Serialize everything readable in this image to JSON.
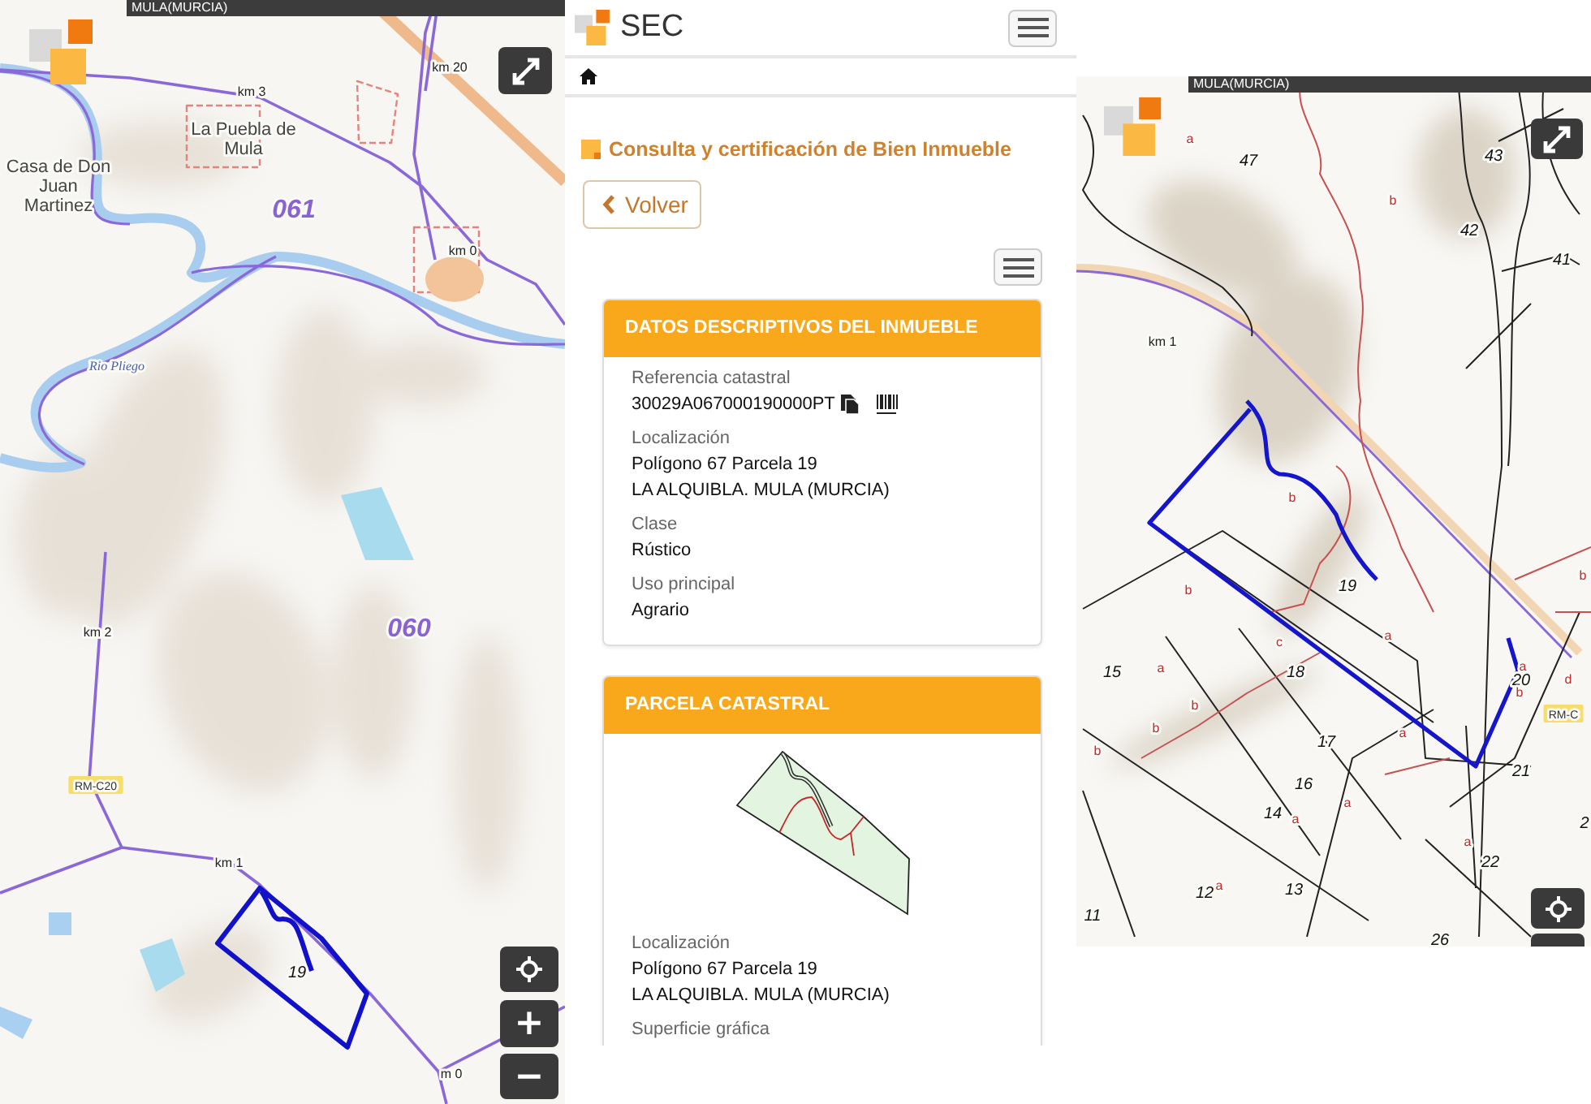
{
  "left_map": {
    "region_label": "MULA(MURCIA)",
    "labels": [
      {
        "kind": "km",
        "text": "km 3"
      },
      {
        "kind": "km",
        "text": "km 20"
      },
      {
        "kind": "place",
        "lines": [
          "La Puebla de",
          "Mula"
        ]
      },
      {
        "kind": "place",
        "lines": [
          "Casa de Don",
          "Juan",
          "Martinez"
        ]
      },
      {
        "kind": "zone",
        "text": "061"
      },
      {
        "kind": "km",
        "text": "km 0"
      },
      {
        "kind": "river",
        "text": "Rio Pliego"
      },
      {
        "kind": "km",
        "text": "km 2"
      },
      {
        "kind": "zone",
        "text": "060"
      },
      {
        "kind": "road",
        "text": "RM-C20"
      },
      {
        "kind": "km",
        "text": "km 1"
      },
      {
        "kind": "parcel",
        "text": "19"
      },
      {
        "kind": "km",
        "text": "m 0"
      }
    ],
    "zoom_in": "+",
    "zoom_out": "−"
  },
  "app": {
    "brand": "SEC",
    "page_title": "Consulta y certificación de Bien Inmueble",
    "back_button": "Volver",
    "cards": [
      {
        "kind": "details",
        "title": "DATOS DESCRIPTIVOS DEL INMUEBLE",
        "fields": [
          {
            "kind": "reference",
            "label": "Referencia catastral",
            "lines": [
              "30029A067000190000PT"
            ]
          },
          {
            "kind": "plain",
            "label": "Localización",
            "lines": [
              "Polígono 67 Parcela 19",
              "LA ALQUIBLA. MULA (MURCIA)"
            ]
          },
          {
            "kind": "plain",
            "label": "Clase",
            "lines": [
              "Rústico"
            ]
          },
          {
            "kind": "plain",
            "label": "Uso principal",
            "lines": [
              "Agrario"
            ]
          }
        ]
      },
      {
        "kind": "parcel",
        "title": "PARCELA CATASTRAL",
        "fields": [
          {
            "kind": "plain",
            "label": "Localización",
            "lines": [
              "Polígono 67 Parcela 19",
              "LA ALQUIBLA. MULA (MURCIA)"
            ]
          },
          {
            "label": "Superficie gráfica"
          }
        ]
      }
    ]
  },
  "right_map": {
    "region_label": "MULA(MURCIA)",
    "labels": [
      {
        "kind": "subparcel",
        "text": "a"
      },
      {
        "kind": "parcel",
        "text": "47"
      },
      {
        "kind": "subparcel",
        "text": "b"
      },
      {
        "kind": "parcel",
        "text": "43"
      },
      {
        "kind": "parcel",
        "text": "42"
      },
      {
        "kind": "parcel",
        "text": "41"
      },
      {
        "kind": "km",
        "text": "km 1"
      },
      {
        "kind": "subparcel",
        "text": "b"
      },
      {
        "kind": "subparcel",
        "text": "b"
      },
      {
        "kind": "parcel",
        "text": "19"
      },
      {
        "kind": "subparcel",
        "text": "a"
      },
      {
        "kind": "subparcel",
        "text": "b"
      },
      {
        "kind": "parcel",
        "text": "15"
      },
      {
        "kind": "subparcel",
        "text": "a"
      },
      {
        "kind": "subparcel",
        "text": "c"
      },
      {
        "kind": "parcel",
        "text": "18"
      },
      {
        "kind": "subparcel",
        "text": "a"
      },
      {
        "kind": "parcel",
        "text": "20"
      },
      {
        "kind": "subparcel",
        "text": "b"
      },
      {
        "kind": "subparcel",
        "text": "d"
      },
      {
        "kind": "road",
        "text": "RM-C"
      },
      {
        "kind": "subparcel",
        "text": "b"
      },
      {
        "kind": "subparcel",
        "text": "b"
      },
      {
        "kind": "subparcel",
        "text": "b"
      },
      {
        "kind": "parcel",
        "text": "17"
      },
      {
        "kind": "subparcel",
        "text": "a"
      },
      {
        "kind": "parcel",
        "text": "21"
      },
      {
        "kind": "parcel",
        "text": "16"
      },
      {
        "kind": "subparcel",
        "text": "a"
      },
      {
        "kind": "parcel",
        "text": "14"
      },
      {
        "kind": "subparcel",
        "text": "a"
      },
      {
        "kind": "subparcel",
        "text": "a"
      },
      {
        "kind": "parcel",
        "text": "22"
      },
      {
        "kind": "parcel",
        "text": "2"
      },
      {
        "kind": "parcel",
        "text": "12"
      },
      {
        "kind": "subparcel",
        "text": "a"
      },
      {
        "kind": "parcel",
        "text": "13"
      },
      {
        "kind": "parcel",
        "text": "11"
      },
      {
        "kind": "parcel",
        "text": "26"
      }
    ]
  }
}
